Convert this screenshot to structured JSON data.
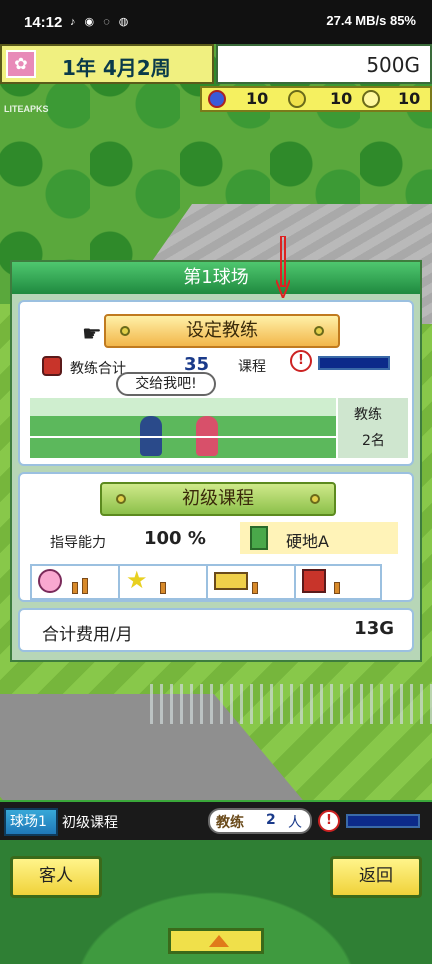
{
  "status_bar": {
    "time": "14:12",
    "right": "27.4 MB/s  85%"
  },
  "hud": {
    "date": "1年 4月2周",
    "money": "500G",
    "stats": [
      "10",
      "10",
      "10"
    ]
  },
  "watermark": "LITEAPKS",
  "panel": {
    "title": "第1球场",
    "coach_section": {
      "button_label": "设定教练",
      "coach_total_label": "教练合计",
      "coach_total_value": "35",
      "course_label": "课程",
      "speech": "交给我吧!",
      "coach_title": "教练",
      "coach_count": "2名"
    },
    "course_section": {
      "button_label": "初级课程",
      "ability_label": "指导能力",
      "ability_value": "100 %",
      "court_type": "硬地A"
    },
    "cost_section": {
      "label": "合计费用/月",
      "value": "13G"
    }
  },
  "infobar": {
    "court_label": "球场1",
    "course_name": "初级课程",
    "coach_label": "教练",
    "coach_count": "2",
    "coach_unit": "人"
  },
  "buttons": {
    "guest": "客人",
    "back": "返回"
  },
  "colors": {
    "title_bar": "#1f8a3f",
    "accent_yellow": "#f5f060",
    "meter_blue": "#0c2a8a"
  }
}
